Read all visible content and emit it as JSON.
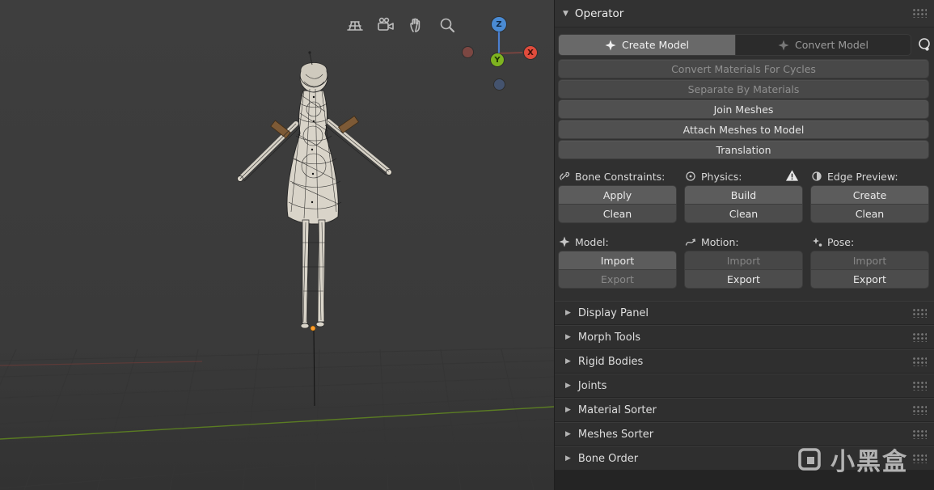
{
  "viewport": {
    "toolbar_icons": [
      "grid",
      "camera",
      "pan-hand",
      "zoom"
    ],
    "gizmo": {
      "z_label": "Z",
      "y_label": "Y",
      "x_label": "X"
    }
  },
  "operator": {
    "title": "Operator",
    "tabs": [
      {
        "label": "Create Model",
        "active": true
      },
      {
        "label": "Convert Model",
        "active": false
      }
    ],
    "action_buttons": [
      {
        "label": "Convert Materials For Cycles",
        "enabled": false
      },
      {
        "label": "Separate By Materials",
        "enabled": false
      },
      {
        "label": "Join Meshes",
        "enabled": true
      },
      {
        "label": "Attach Meshes to Model",
        "enabled": true
      },
      {
        "label": "Translation",
        "enabled": true
      }
    ],
    "tool_groups": [
      {
        "label": "Bone Constraints:",
        "warning": false,
        "buttons": [
          {
            "label": "Apply",
            "enabled": true
          },
          {
            "label": "Clean",
            "enabled": true
          }
        ]
      },
      {
        "label": "Physics:",
        "warning": true,
        "buttons": [
          {
            "label": "Build",
            "enabled": true
          },
          {
            "label": "Clean",
            "enabled": true
          }
        ]
      },
      {
        "label": "Edge Preview:",
        "warning": false,
        "buttons": [
          {
            "label": "Create",
            "enabled": true
          },
          {
            "label": "Clean",
            "enabled": true
          }
        ]
      }
    ],
    "io_groups": [
      {
        "label": "Model:",
        "buttons": [
          {
            "label": "Import",
            "enabled": true
          },
          {
            "label": "Export",
            "enabled": false
          }
        ]
      },
      {
        "label": "Motion:",
        "buttons": [
          {
            "label": "Import",
            "enabled": false
          },
          {
            "label": "Export",
            "enabled": true
          }
        ]
      },
      {
        "label": "Pose:",
        "buttons": [
          {
            "label": "Import",
            "enabled": false
          },
          {
            "label": "Export",
            "enabled": true
          }
        ]
      }
    ],
    "collapsed_panels": [
      "Display Panel",
      "Morph Tools",
      "Rigid Bodies",
      "Joints",
      "Material Sorter",
      "Meshes Sorter",
      "Bone Order"
    ]
  },
  "watermark": {
    "text": "小黑盒"
  },
  "colors": {
    "axis_x": "#e04c3c",
    "axis_y": "#7eb320",
    "axis_z": "#4a8bd4",
    "armature_root": "#ff9d2a",
    "floor_axis_green": "#5d8022"
  }
}
